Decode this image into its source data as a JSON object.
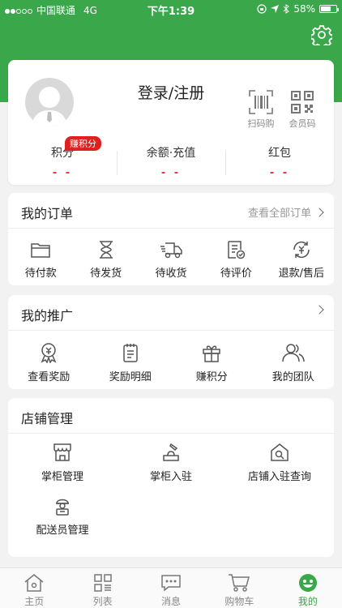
{
  "status_bar": {
    "carrier": "中国联通",
    "network": "4G",
    "time": "下午1:39",
    "battery": "58%"
  },
  "profile": {
    "login_label": "登录/注册",
    "scan_label": "扫码购",
    "member_code_label": "会员码",
    "stats": [
      {
        "label": "积分",
        "value": "- -",
        "badge": "赚积分"
      },
      {
        "label": "余额·充值",
        "value": "- -"
      },
      {
        "label": "红包",
        "value": "- -"
      }
    ]
  },
  "orders": {
    "title": "我的订单",
    "view_all": "查看全部订单",
    "items": [
      {
        "label": "待付款",
        "icon": "wallet-icon"
      },
      {
        "label": "待发货",
        "icon": "hourglass-icon"
      },
      {
        "label": "待收货",
        "icon": "truck-icon"
      },
      {
        "label": "待评价",
        "icon": "review-icon"
      },
      {
        "label": "退款/售后",
        "icon": "refund-icon"
      }
    ]
  },
  "promotion": {
    "title": "我的推广",
    "items": [
      {
        "label": "查看奖励",
        "icon": "medal-icon"
      },
      {
        "label": "奖励明细",
        "icon": "clipboard-icon"
      },
      {
        "label": "赚积分",
        "icon": "gift-icon"
      },
      {
        "label": "我的团队",
        "icon": "team-icon"
      }
    ]
  },
  "store": {
    "title": "店铺管理",
    "items": [
      {
        "label": "掌柜管理",
        "icon": "shop-icon"
      },
      {
        "label": "掌柜入驻",
        "icon": "register-icon"
      },
      {
        "label": "店铺入驻查询",
        "icon": "store-search-icon"
      },
      {
        "label": "配送员管理",
        "icon": "courier-icon"
      }
    ]
  },
  "tabbar": [
    {
      "label": "主页",
      "icon": "home-icon"
    },
    {
      "label": "列表",
      "icon": "list-icon"
    },
    {
      "label": "消息",
      "icon": "message-icon"
    },
    {
      "label": "购物车",
      "icon": "cart-icon"
    },
    {
      "label": "我的",
      "icon": "profile-icon",
      "active": true
    }
  ],
  "colors": {
    "brand_green": "#3aa74a",
    "accent_red": "#e02020"
  }
}
